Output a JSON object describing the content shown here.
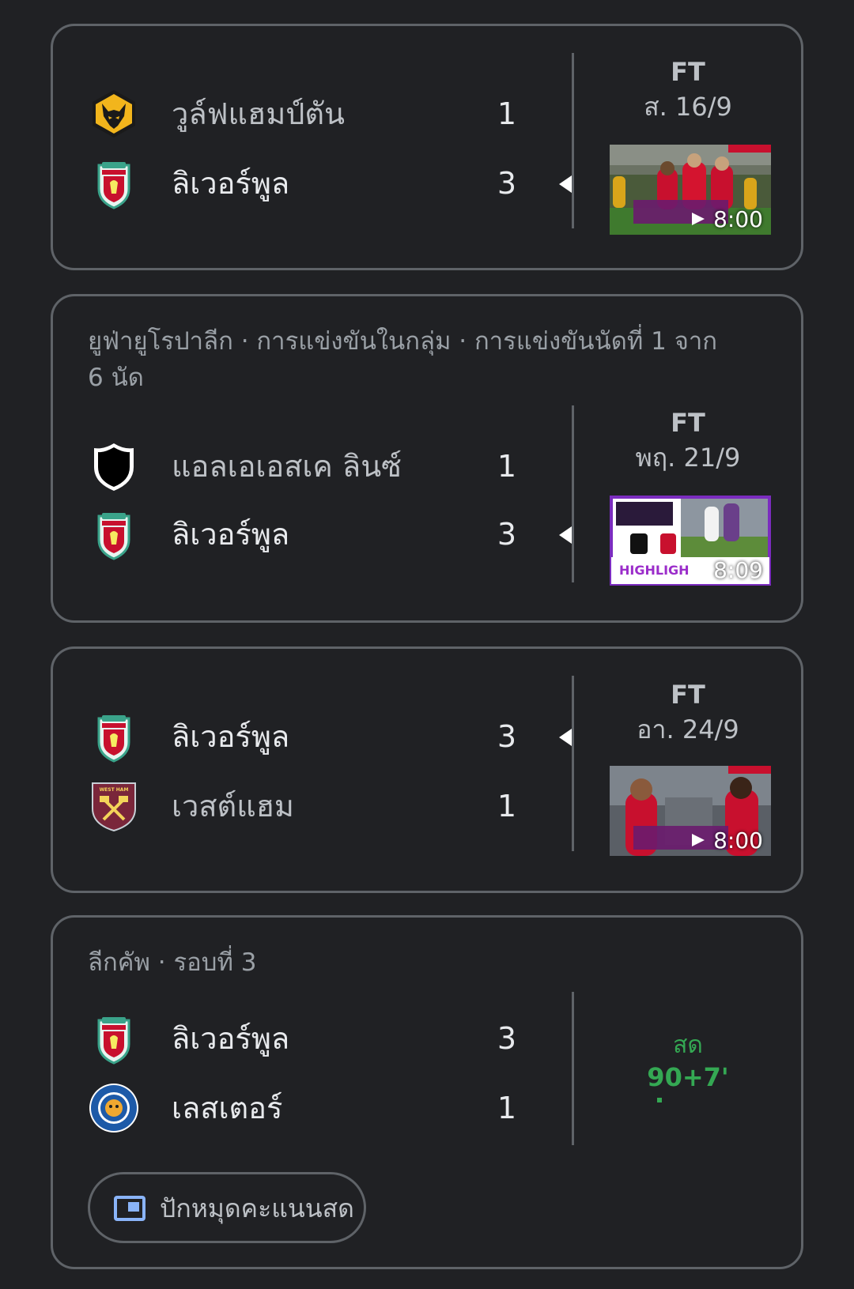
{
  "matches": [
    {
      "competition": "",
      "home": {
        "name": "วูล์ฟแฮมป์ตัน",
        "score": "1",
        "logo_icon": "wolves-crest-icon"
      },
      "away": {
        "name": "ลิเวอร์พูล",
        "score": "3",
        "logo_icon": "liverpool-crest-icon"
      },
      "winner": "away",
      "status": "FT",
      "date": "ส. 16/9",
      "video_duration": "8:00"
    },
    {
      "competition": "ยูฟ่ายูโรปาลีก · การแข่งขันในกลุ่ม · การแข่งขันนัดที่ 1 จาก 6 นัด",
      "home": {
        "name": "แอลเอเอสเค ลินซ์",
        "score": "1",
        "logo_icon": "lask-linz-crest-icon"
      },
      "away": {
        "name": "ลิเวอร์พูล",
        "score": "3",
        "logo_icon": "liverpool-crest-icon"
      },
      "winner": "away",
      "status": "FT",
      "date": "พฤ. 21/9",
      "video_duration": "8:09"
    },
    {
      "competition": "",
      "home": {
        "name": "ลิเวอร์พูล",
        "score": "3",
        "logo_icon": "liverpool-crest-icon"
      },
      "away": {
        "name": "เวสต์แฮม",
        "score": "1",
        "logo_icon": "west-ham-crest-icon"
      },
      "winner": "home",
      "status": "FT",
      "date": "อา. 24/9",
      "video_duration": "8:00"
    },
    {
      "competition": "ลีกคัพ · รอบที่ 3",
      "home": {
        "name": "ลิเวอร์พูล",
        "score": "3",
        "logo_icon": "liverpool-crest-icon"
      },
      "away": {
        "name": "เลสเตอร์",
        "score": "1",
        "logo_icon": "leicester-crest-icon"
      },
      "winner": "",
      "status": "สด",
      "live_minute": "90+7'",
      "pin_button_label": "ปักหมุดคะแนนสด"
    }
  ],
  "colors": {
    "background": "#202124",
    "card_border": "#5f6368",
    "live_green": "#34a853",
    "text_primary": "#e8eaed",
    "text_secondary": "#9aa0a6"
  }
}
